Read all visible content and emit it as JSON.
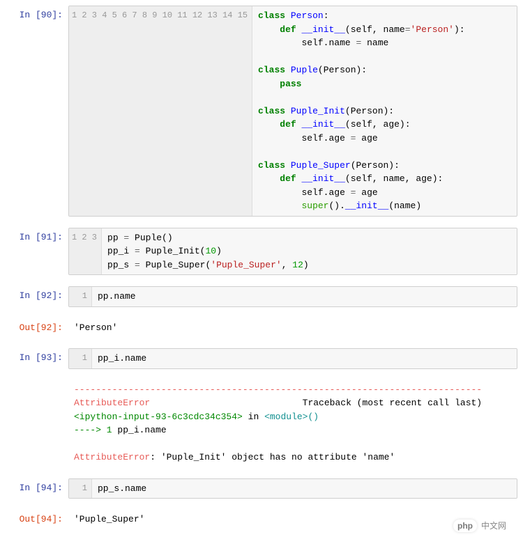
{
  "cells": [
    {
      "type": "code",
      "prompt": "In [90]:",
      "line_count": 15,
      "code_html": "<span class='tok-k'>class</span> <span class='tok-cls'>Person</span>:\n    <span class='tok-k'>def</span> <span class='tok-nf'>__init__</span>(self, name<span class='tok-op'>=</span><span class='tok-s'>'Person'</span>):\n        self.name <span class='tok-op'>=</span> name\n\n<span class='tok-k'>class</span> <span class='tok-cls'>Puple</span>(Person):\n    <span class='tok-k'>pass</span>\n\n<span class='tok-k'>class</span> <span class='tok-cls'>Puple_Init</span>(Person):\n    <span class='tok-k'>def</span> <span class='tok-nf'>__init__</span>(self, age):\n        self.age <span class='tok-op'>=</span> age\n\n<span class='tok-k'>class</span> <span class='tok-cls'>Puple_Super</span>(Person):\n    <span class='tok-k'>def</span> <span class='tok-nf'>__init__</span>(self, name, age):\n        self.age <span class='tok-op'>=</span> age\n        <span class='tok-sup'>super</span>().<span class='tok-nf'>__init__</span>(name)"
    },
    {
      "type": "code",
      "prompt": "In [91]:",
      "line_count": 3,
      "code_html": "pp <span class='tok-op'>=</span> Puple()\npp_i <span class='tok-op'>=</span> Puple_Init(<span class='tok-num'>10</span>)\npp_s <span class='tok-op'>=</span> Puple_Super(<span class='tok-s'>'Puple_Super'</span>, <span class='tok-num'>12</span>)"
    },
    {
      "type": "code",
      "prompt": "In [92]:",
      "line_count": 1,
      "code_html": "pp.name"
    },
    {
      "type": "output",
      "prompt": "Out[92]:",
      "text_html": "'Person'"
    },
    {
      "type": "code",
      "prompt": "In [93]:",
      "line_count": 1,
      "code_html": "pp_i.name"
    },
    {
      "type": "error",
      "prompt": "",
      "text_html": "<span class='tok-ansi-red'>---------------------------------------------------------------------------</span>\n<span class='tok-ansi-red'>AttributeError</span>                            Traceback (most recent call last)\n<span class='tok-ansi-green'>&lt;ipython-input-93-6c3cdc34c354&gt;</span> in <span class='tok-ansi-cyan'>&lt;module&gt;</span><span class='tok-ansi-cyan'>()</span>\n<span class='tok-ansi-green'>----&gt; 1</span> pp_i.name\n\n<span class='tok-ansi-red'>AttributeError</span>: 'Puple_Init' object has no attribute 'name'"
    },
    {
      "type": "code",
      "prompt": "In [94]:",
      "line_count": 1,
      "code_html": "pp_s.name"
    },
    {
      "type": "output",
      "prompt": "Out[94]:",
      "text_html": "'Puple_Super'"
    }
  ],
  "watermark": {
    "badge": "php",
    "text": "中文网"
  }
}
